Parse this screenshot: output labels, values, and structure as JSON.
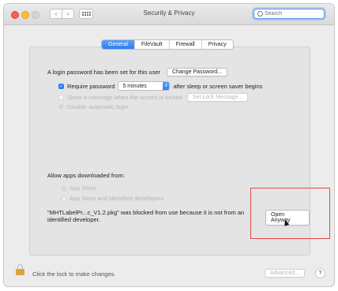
{
  "window": {
    "title": "Security & Privacy"
  },
  "search": {
    "placeholder": "Search"
  },
  "tabs": [
    {
      "label": "General",
      "active": true
    },
    {
      "label": "FileVault",
      "active": false
    },
    {
      "label": "Firewall",
      "active": false
    },
    {
      "label": "Privacy",
      "active": false
    }
  ],
  "login": {
    "message": "A login password has been set for this user",
    "change_password_label": "Change Password...",
    "require_password_label": "Require password",
    "require_password_checked": true,
    "delay_value": "5 minutes",
    "after_label": "after sleep or screen saver begins",
    "show_message_label": "Show a message when the screen is locked",
    "set_lock_message_label": "Set Lock Message...",
    "disable_auto_login_label": "Disable automatic login"
  },
  "apps": {
    "heading": "Allow apps downloaded from:",
    "options": [
      {
        "label": "App Store",
        "selected": true
      },
      {
        "label": "App Store and identified developers",
        "selected": false
      }
    ],
    "blocked_message": "\"MHTLabelPr...c_V1.2.pkg\" was blocked from use because it is not from an identified developer.",
    "open_anyway_label": "Open Anyway"
  },
  "footer": {
    "lock_text": "Click the lock to make changes.",
    "advanced_label": "Advanced...",
    "help_label": "?"
  },
  "colors": {
    "accent": "#2f7ef0",
    "highlight": "#e04848",
    "lock": "#e0a23a"
  },
  "icons": [
    "search-icon",
    "chevron-left-icon",
    "chevron-right-icon",
    "grid-icon",
    "lock-icon",
    "help-icon"
  ]
}
